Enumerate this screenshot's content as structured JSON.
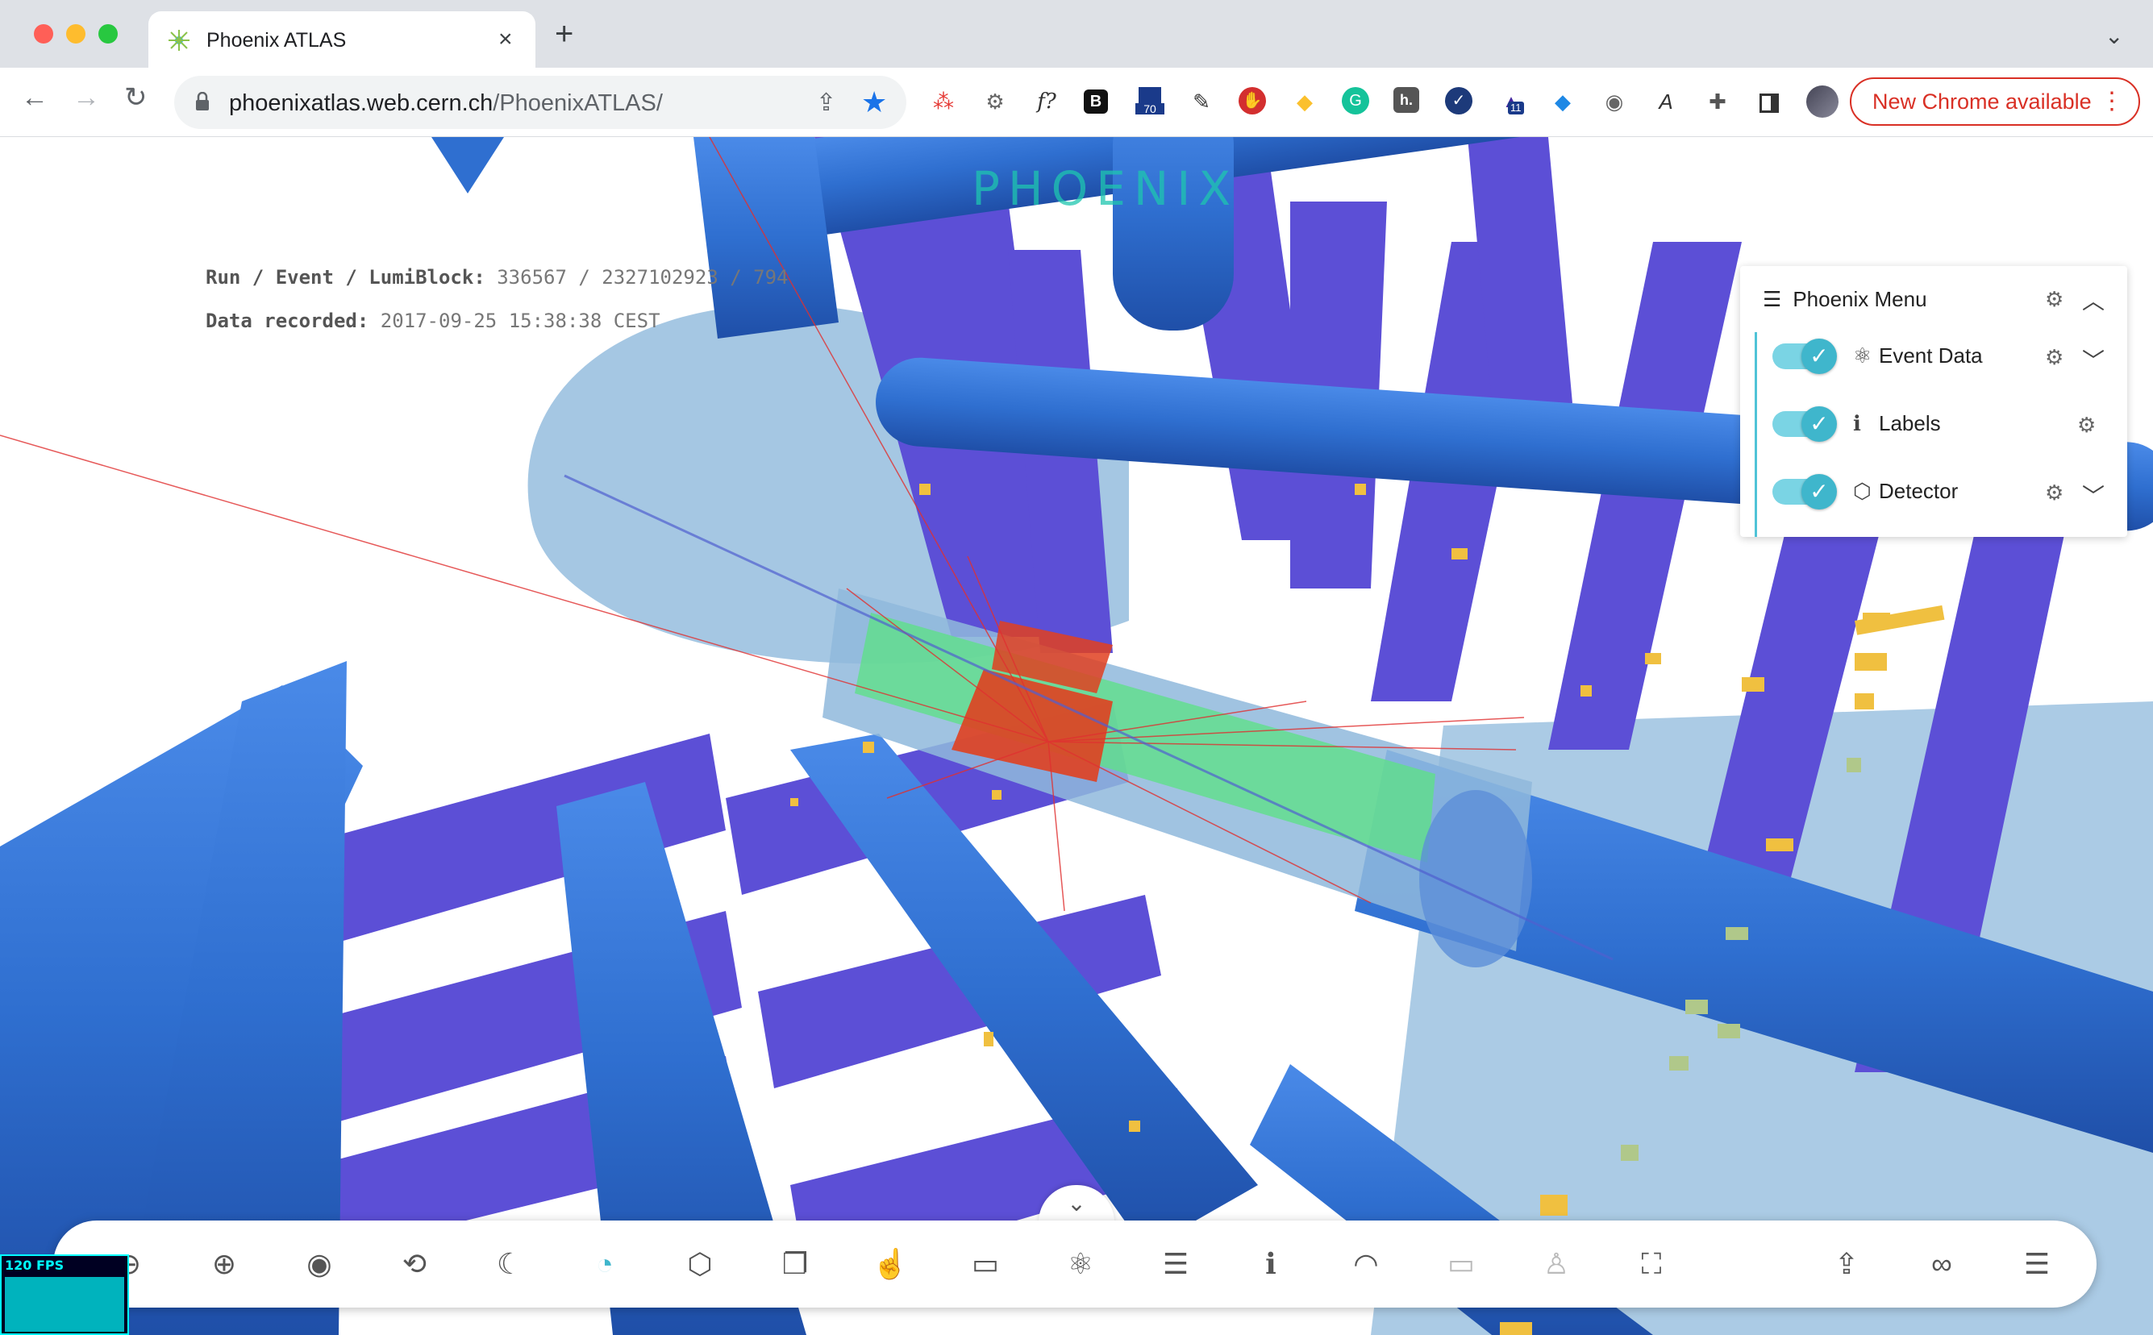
{
  "browser": {
    "tab_title": "Phoenix ATLAS",
    "close_glyph": "×",
    "new_tab_glyph": "+",
    "url_host": "phoenixatlas.web.cern.ch",
    "url_path": "/PhoenixATLAS/",
    "update_button": "New Chrome available",
    "extensions": [
      "f?",
      "B",
      "70",
      "h.",
      "11"
    ]
  },
  "event_info": {
    "run_label": "Run / Event / LumiBlock:",
    "run_value": "336567 / 2327102923 / 794",
    "date_label": "Data recorded:",
    "date_value": "2017-09-25 15:38:38 CEST"
  },
  "logo_text": "PHOENIX",
  "phoenix_menu": {
    "title": "Phoenix Menu",
    "items": [
      {
        "label": "Event Data",
        "checked": true,
        "icon": "atom-icon"
      },
      {
        "label": "Labels",
        "checked": true,
        "icon": "info-icon"
      },
      {
        "label": "Detector",
        "checked": true,
        "icon": "cube-icon"
      }
    ]
  },
  "fps": {
    "label": "120 FPS"
  },
  "colors": {
    "detector_blue": "#2f6fd0",
    "detector_purple": "#5c4fd6",
    "cone": "#8fb9dc",
    "calorimeter_red": "#e04020",
    "calorimeter_green": "#5fe08a",
    "hits": "#f0c040",
    "accent": "#3fb6cc"
  },
  "bottom_toolbar": {
    "icons": [
      "zoom-out-icon",
      "zoom-in-icon",
      "view-icon",
      "rotate-icon",
      "dark-mode-icon",
      "clip-icon",
      "cube-icon",
      "overlay-icon",
      "select-icon",
      "info-panel-icon",
      "atom-icon",
      "animate-icon",
      "labels-icon",
      "performance-icon",
      "vr-icon",
      "ar-icon",
      "screenshot-icon",
      "export-icon",
      "share-link-icon",
      "io-options-icon"
    ]
  }
}
